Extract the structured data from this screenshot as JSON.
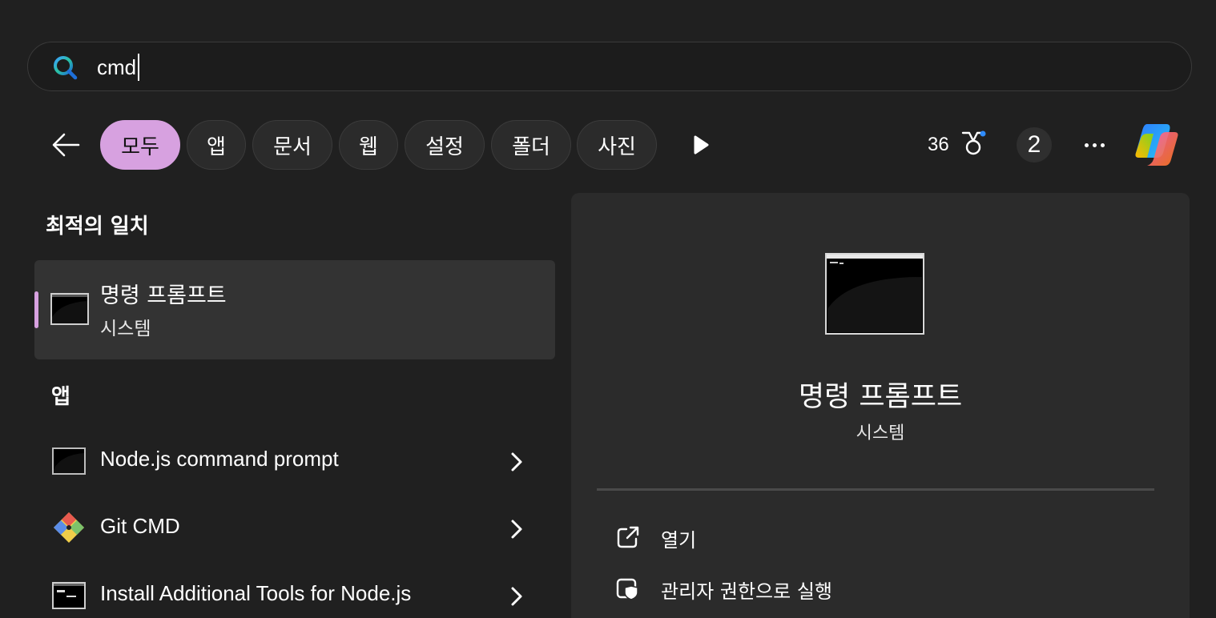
{
  "search": {
    "query": "cmd"
  },
  "filters": {
    "chips": [
      {
        "label": "모두",
        "active": true
      },
      {
        "label": "앱",
        "active": false
      },
      {
        "label": "문서",
        "active": false
      },
      {
        "label": "웹",
        "active": false
      },
      {
        "label": "설정",
        "active": false
      },
      {
        "label": "폴더",
        "active": false
      },
      {
        "label": "사진",
        "active": false
      }
    ]
  },
  "toolbar": {
    "points": "36",
    "badge_count": "2"
  },
  "best_match": {
    "heading": "최적의 일치",
    "title": "명령 프롬프트",
    "subtitle": "시스템",
    "icon": "cmd-icon"
  },
  "apps": {
    "heading": "앱",
    "items": [
      {
        "label": "Node.js command prompt",
        "icon": "cmd-icon"
      },
      {
        "label": "Git CMD",
        "icon": "git-icon"
      },
      {
        "label": "Install Additional Tools for Node.js",
        "icon": "console-icon"
      }
    ]
  },
  "detail": {
    "title": "명령 프롬프트",
    "subtitle": "시스템",
    "actions": [
      {
        "label": "열기",
        "icon": "open-external-icon"
      },
      {
        "label": "관리자 권한으로 실행",
        "icon": "shield-run-icon"
      }
    ]
  },
  "colors": {
    "accent": "#d7a1e0",
    "background": "#202020",
    "panel": "#2b2b2b",
    "selected": "#333333"
  }
}
